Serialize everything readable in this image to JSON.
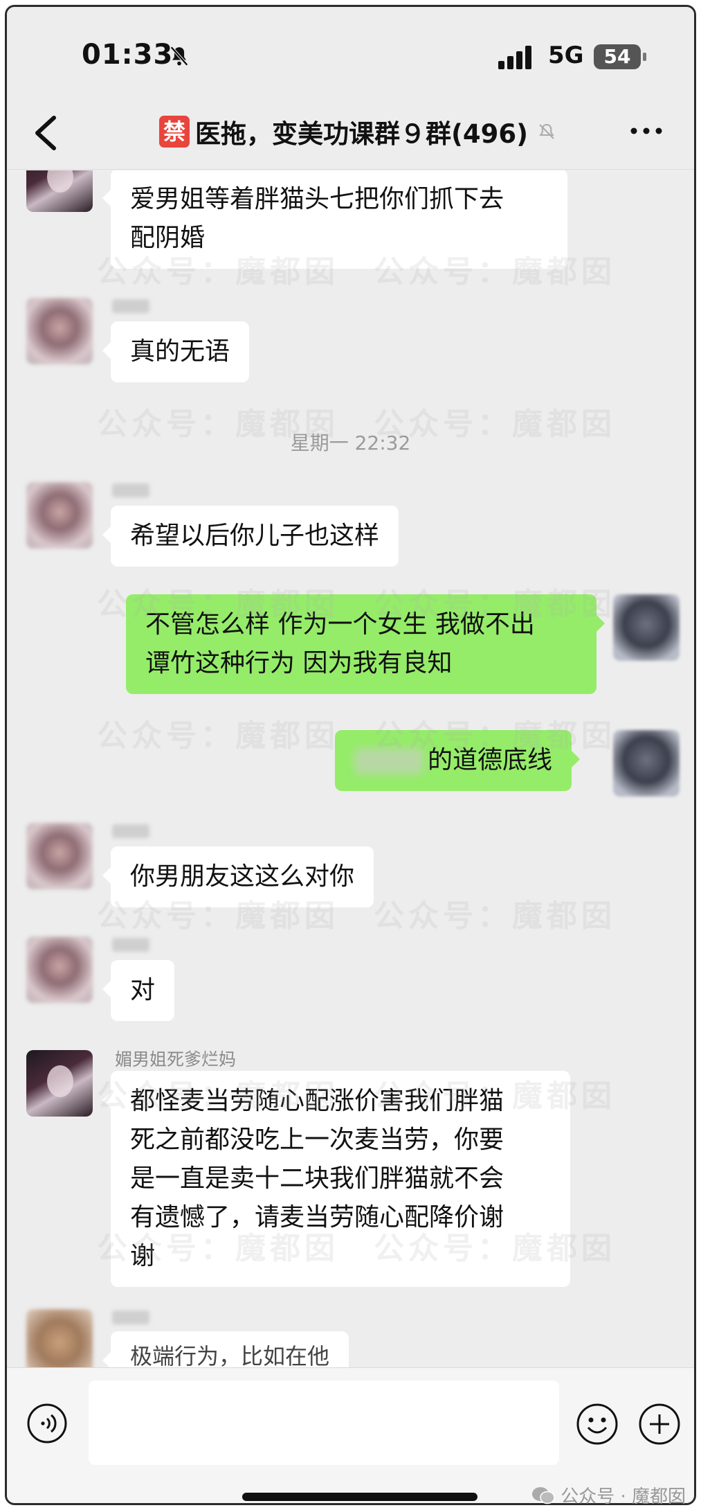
{
  "status_bar": {
    "time": "01:33",
    "network": "5G",
    "battery": "54"
  },
  "nav": {
    "ban_badge": "禁",
    "title": "医拖，变美功课群９群(496)"
  },
  "messages": [
    {
      "sender": "",
      "text_lines": [
        "爱男姐等着胖猫头七把你们抓下去",
        "配阴婚"
      ]
    },
    {
      "sender": "",
      "text_lines": [
        "真的无语"
      ]
    },
    {
      "sender": "",
      "text_lines": [
        "希望以后你儿子也这样"
      ]
    },
    {
      "sender": "me",
      "text_lines": [
        "不管怎么样 作为一个女生 我做不出",
        "谭竹这种行为 因为我有良知"
      ]
    },
    {
      "sender": "me",
      "text_lines": [
        "的道德底线"
      ]
    },
    {
      "sender": "",
      "text_lines": [
        "你男朋友这这么对你"
      ]
    },
    {
      "sender": "",
      "text_lines": [
        "对"
      ]
    },
    {
      "sender": "媚男姐死爹烂妈",
      "text_lines": [
        "都怪麦当劳随心配涨价害我们胖猫",
        "死之前都没吃上一次麦当劳，你要",
        "是一直是卖十二块我们胖猫就不会",
        "有遗憾了，请麦当劳随心配降价谢",
        "谢"
      ]
    },
    {
      "sender": "",
      "text_lines": [
        "极端行为，比如在他"
      ]
    }
  ],
  "timestamp": "星期一 22:32",
  "watermark": {
    "text": "公众号：魔都囡"
  },
  "footer": {
    "text": "公众号 · 魔都囡"
  },
  "colors": {
    "self_bubble": "#95ec69",
    "background": "#ededed",
    "ban_badge": "#e8453c"
  }
}
